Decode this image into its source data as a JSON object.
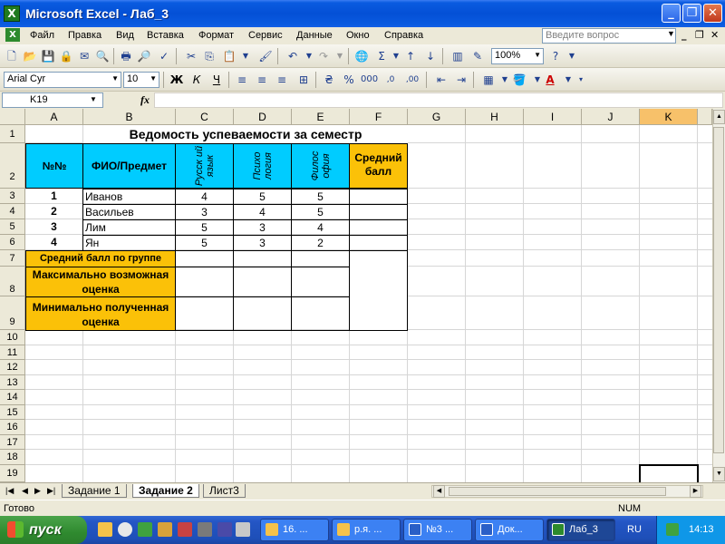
{
  "window": {
    "title": "Microsoft Excel - Лаб_3"
  },
  "menu": {
    "items": [
      "Файл",
      "Правка",
      "Вид",
      "Вставка",
      "Формат",
      "Сервис",
      "Данные",
      "Окно",
      "Справка"
    ],
    "help_placeholder": "Введите вопрос"
  },
  "toolbar": {
    "zoom": "100%",
    "font_name": "Arial Cyr",
    "font_size": "10"
  },
  "formula_bar": {
    "cell_ref": "K19",
    "fx": "fx",
    "value": ""
  },
  "columns": [
    "A",
    "B",
    "C",
    "D",
    "E",
    "F",
    "G",
    "H",
    "I",
    "J",
    "K"
  ],
  "rows": [
    "1",
    "2",
    "3",
    "4",
    "5",
    "6",
    "7",
    "8",
    "9",
    "10",
    "11",
    "12",
    "13",
    "14",
    "15",
    "16",
    "17",
    "18",
    "19"
  ],
  "sheet": {
    "title": "Ведомость успеваемости за семестр",
    "header_num": "№№",
    "header_name": "ФИО/Предмет",
    "header_subj1": "Русск ий язык",
    "header_subj2": "Психо логия",
    "header_subj3": "Филос офия",
    "header_avg": "Средний балл",
    "students": [
      {
        "num": "1",
        "name": "Иванов",
        "s1": "4",
        "s2": "5",
        "s3": "5"
      },
      {
        "num": "2",
        "name": "Васильев",
        "s1": "3",
        "s2": "4",
        "s3": "5"
      },
      {
        "num": "3",
        "name": "Лим",
        "s1": "5",
        "s2": "3",
        "s3": "4"
      },
      {
        "num": "4",
        "name": "Ян",
        "s1": "5",
        "s2": "3",
        "s3": "2"
      }
    ],
    "group_avg": "Средний балл по группе",
    "max_grade": "Максимально возможная оценка",
    "min_grade": "Минимально полученная оценка"
  },
  "tabs": [
    "Задание 1",
    "Задание 2",
    "Лист3"
  ],
  "active_tab": "Задание 2",
  "status": {
    "text": "Готово",
    "num": "NUM"
  },
  "taskbar": {
    "start": "пуск",
    "buttons": [
      "16. ...",
      "р.я. ...",
      "№3 ...",
      "Док...",
      "Лаб_3"
    ],
    "lang": "RU",
    "clock": "14:13"
  }
}
